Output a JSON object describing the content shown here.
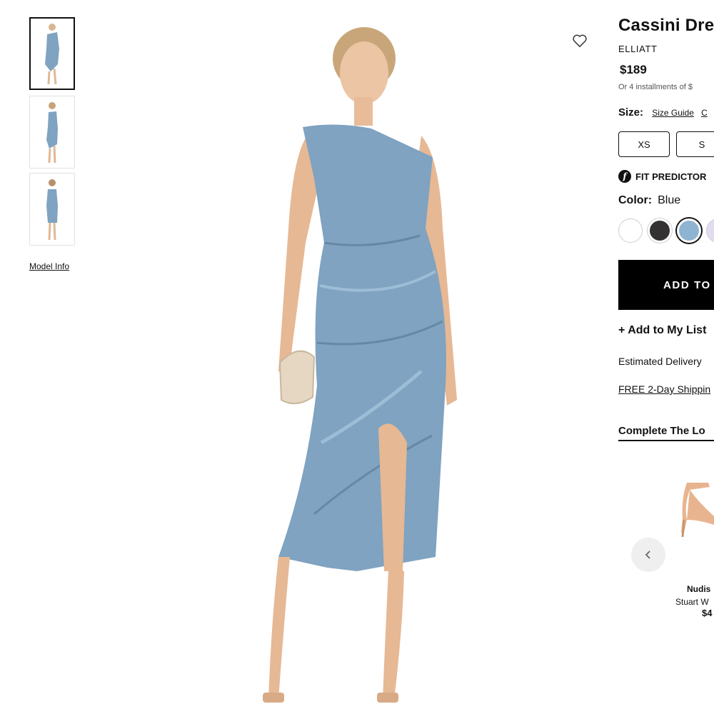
{
  "thumbnails": [
    {
      "label": "front view",
      "active": true
    },
    {
      "label": "side view",
      "active": false
    },
    {
      "label": "back view",
      "active": false
    }
  ],
  "model_info": "Model Info",
  "icons": {
    "wishlist": "heart-icon",
    "fit_predictor": "fit-predictor-logo-icon",
    "carousel_prev": "chevron-left-icon"
  },
  "product": {
    "title": "Cassini Dre",
    "brand": "ELLIATT",
    "price": "$189",
    "installments": "Or 4 installments of $"
  },
  "size": {
    "label": "Size:",
    "size_guide": "Size Guide",
    "extra_link": "C",
    "options": [
      "XS",
      "S"
    ]
  },
  "fit_predictor": {
    "label": "FIT PREDICTOR"
  },
  "color": {
    "label": "Color:",
    "selected": "Blue",
    "swatches": [
      {
        "name": "white",
        "hex": "#ffffff",
        "selected": false
      },
      {
        "name": "charcoal",
        "hex": "#343132",
        "selected": false
      },
      {
        "name": "blue",
        "hex": "#8fb4d2",
        "selected": true
      },
      {
        "name": "lavender",
        "hex": "#e3dcf0",
        "selected": false
      }
    ]
  },
  "actions": {
    "add_to_bag": "ADD TO",
    "add_to_list": "+ Add to My List"
  },
  "delivery": {
    "estimated": "Estimated Delivery",
    "shipping": "FREE 2-Day Shippin"
  },
  "complete_the_look": {
    "heading": "Complete The Lo",
    "product": {
      "name": "Nudis",
      "brand": "Stuart W",
      "price": "$4"
    }
  },
  "colors": {
    "accent": "#000000",
    "dress": "#7fa3c1"
  }
}
